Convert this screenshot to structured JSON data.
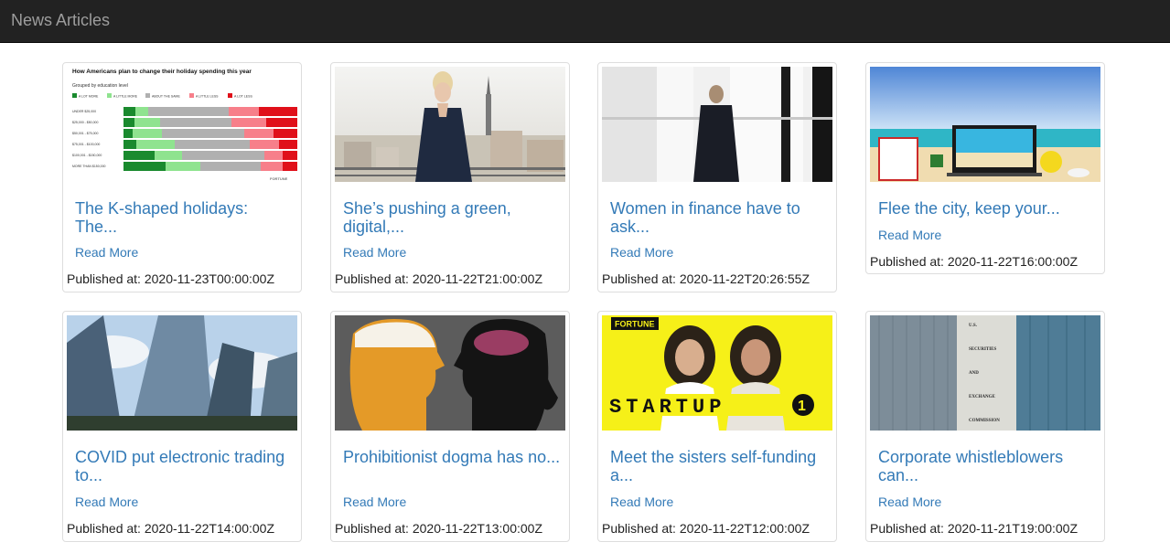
{
  "navbar": {
    "brand": "News Articles"
  },
  "labels": {
    "read_more": "Read More",
    "published_at": "Published at:"
  },
  "articles": [
    {
      "title": "The K-shaped holidays: The...",
      "published": "2020-11-23T00:00:00Z",
      "image": {
        "kind": "chart",
        "chart_title": "How Americans plan to change their holiday spending this year",
        "chart_subtitle": "Grouped by education level",
        "legend": [
          "A LOT MORE",
          "A LITTLE MORE",
          "ABOUT THE SAME",
          "A LITTLE LESS",
          "A LOT LESS"
        ],
        "rows": [
          "UNDER $25,000",
          "$25,000 - $50,000",
          "$50,001 - $75,000",
          "$75,001 - $100,000",
          "$100,001 - $150,000",
          "MORE THAN $150,000"
        ],
        "footer": "FORTUNE",
        "colors": [
          "#1a8a2e",
          "#8fe38f",
          "#b0b0b0",
          "#f77f8a",
          "#e0101a"
        ]
      }
    },
    {
      "title": "She’s pushing a green, digital,...",
      "published": "2020-11-22T21:00:00Z",
      "image": {
        "kind": "woman-city"
      }
    },
    {
      "title": "Women in finance have to ask...",
      "published": "2020-11-22T20:26:55Z",
      "image": {
        "kind": "woman-window"
      }
    },
    {
      "title": "Flee the city, keep your...",
      "published": "2020-11-22T16:00:00Z",
      "image": {
        "kind": "beach-desk"
      }
    },
    {
      "title": "COVID put electronic trading to...",
      "published": "2020-11-22T14:00:00Z",
      "image": {
        "kind": "skyscrapers"
      }
    },
    {
      "title": "Prohibitionist dogma has no...",
      "published": "2020-11-22T13:00:00Z",
      "image": {
        "kind": "heads"
      }
    },
    {
      "title": "Meet the sisters self-funding a...",
      "published": "2020-11-22T12:00:00Z",
      "image": {
        "kind": "startup",
        "badge": "FORTUNE",
        "word": "STARTUP",
        "year_label": "1"
      }
    },
    {
      "title": "Corporate whistleblowers can...",
      "published": "2020-11-21T19:00:00Z",
      "image": {
        "kind": "sec-building",
        "facade_lines": [
          "U.S.",
          "SECURITIES",
          "AND",
          "EXCHANGE",
          "COMMISSION"
        ]
      }
    }
  ]
}
